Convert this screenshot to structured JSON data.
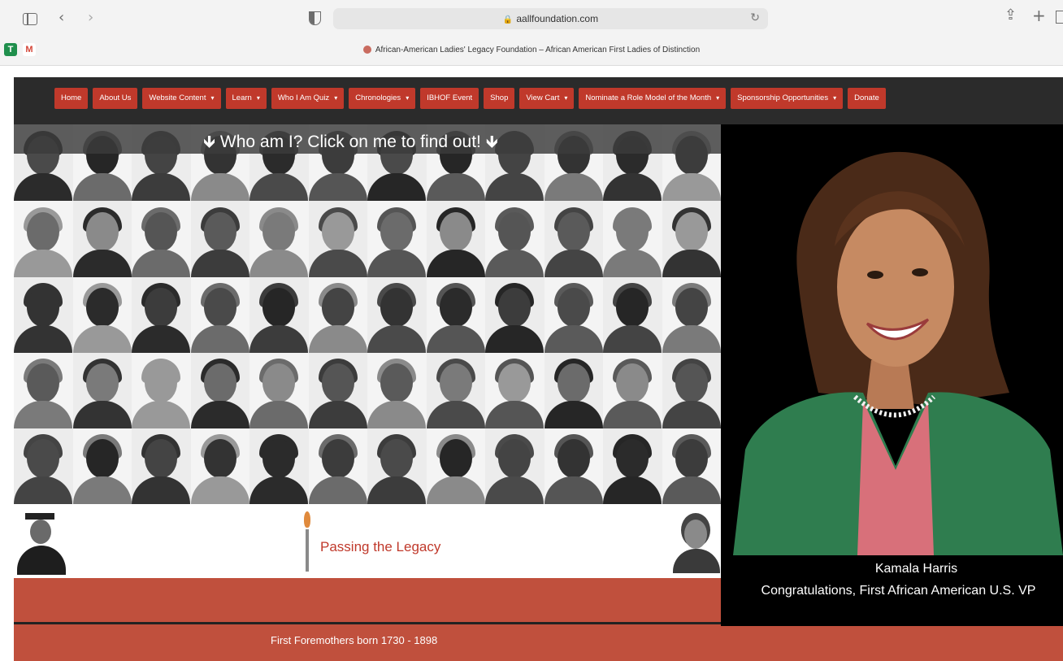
{
  "browser": {
    "url": "aallfoundation.com",
    "tab_title": "African-American Ladies' Legacy Foundation – African American First Ladies of Distinction",
    "bookmarks": [
      "T",
      "M"
    ]
  },
  "nav": {
    "items": [
      {
        "label": "Home",
        "dropdown": false
      },
      {
        "label": "About Us",
        "dropdown": false
      },
      {
        "label": "Website Content",
        "dropdown": true
      },
      {
        "label": "Learn",
        "dropdown": true
      },
      {
        "label": "Who I Am Quiz",
        "dropdown": true
      },
      {
        "label": "Chronologies",
        "dropdown": true
      },
      {
        "label": "IBHOF Event",
        "dropdown": false
      },
      {
        "label": "Shop",
        "dropdown": false
      },
      {
        "label": "View Cart",
        "dropdown": true
      },
      {
        "label": "Nominate a Role Model of the Month",
        "dropdown": true
      },
      {
        "label": "Sponsorship Opportunities",
        "dropdown": true
      },
      {
        "label": "Donate",
        "dropdown": false
      }
    ]
  },
  "banner": {
    "text": "🡻 Who am I? Click on me to find out! 🡻"
  },
  "legacy": {
    "text": "Passing the Legacy"
  },
  "footer": {
    "text": "First Foremothers born 1730 - 1898"
  },
  "featured": {
    "name": "Kamala Harris",
    "caption": "Congratulations, First African American U.S. VP"
  },
  "colors": {
    "accent": "#c0392b",
    "nav_bg": "#2b2b2b",
    "band": "#c0503d"
  }
}
